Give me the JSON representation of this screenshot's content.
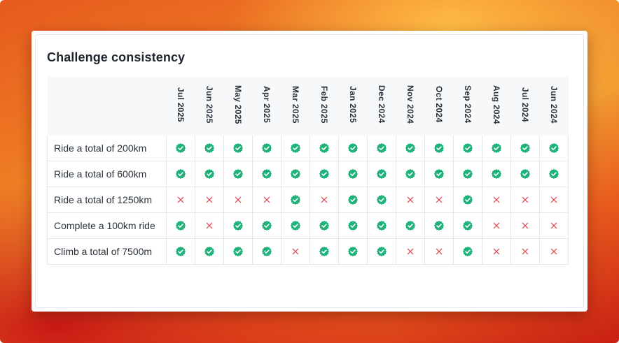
{
  "card": {
    "title": "Challenge consistency"
  },
  "table": {
    "months": [
      "Jul 2025",
      "Jun 2025",
      "May 2025",
      "Apr 2025",
      "Mar 2025",
      "Feb 2025",
      "Jan 2025",
      "Dec 2024",
      "Nov 2024",
      "Oct 2024",
      "Sep 2024",
      "Aug 2024",
      "Jul 2024",
      "Jun 2024"
    ],
    "rows": [
      {
        "label": "Ride a total of 200km",
        "status": [
          "completed",
          "completed",
          "completed",
          "completed",
          "completed",
          "completed",
          "completed",
          "completed",
          "completed",
          "completed",
          "completed",
          "completed",
          "completed",
          "completed"
        ]
      },
      {
        "label": "Ride a total of 600km",
        "status": [
          "completed",
          "completed",
          "completed",
          "completed",
          "completed",
          "completed",
          "completed",
          "completed",
          "completed",
          "completed",
          "completed",
          "completed",
          "completed",
          "completed"
        ]
      },
      {
        "label": "Ride a total of 1250km",
        "status": [
          "missed",
          "missed",
          "missed",
          "missed",
          "completed",
          "missed",
          "completed",
          "completed",
          "missed",
          "missed",
          "completed",
          "missed",
          "missed",
          "missed"
        ]
      },
      {
        "label": "Complete a 100km ride",
        "status": [
          "completed",
          "missed",
          "completed",
          "completed",
          "completed",
          "completed",
          "completed",
          "completed",
          "completed",
          "completed",
          "completed",
          "missed",
          "missed",
          "missed"
        ]
      },
      {
        "label": "Climb a total of 7500m",
        "status": [
          "completed",
          "completed",
          "completed",
          "completed",
          "missed",
          "completed",
          "completed",
          "completed",
          "missed",
          "missed",
          "completed",
          "missed",
          "missed",
          "missed"
        ]
      }
    ]
  },
  "icons": {
    "completed": "check-badge-icon",
    "missed": "x-mark-icon"
  },
  "colors": {
    "completed": "#1fb37a",
    "missed": "#e0484d"
  }
}
